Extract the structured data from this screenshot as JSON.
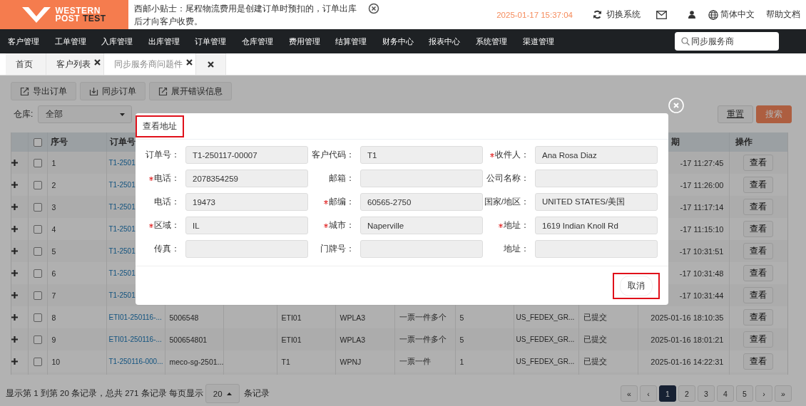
{
  "header": {
    "logo": {
      "line_1": "WESTERN",
      "line_2_a": "POST",
      "line_2_b": "TEST"
    },
    "notice": "西邮小贴士：尾程物流费用是创建订单时预扣的，订单出库后才向客户收费。",
    "datetime": "2025-01-17 15:37:04",
    "switch_system": "切换系统",
    "language": "简体中文",
    "help": "帮助文档"
  },
  "nav": {
    "items": [
      "客户管理",
      "工单管理",
      "入库管理",
      "出库管理",
      "订单管理",
      "仓库管理",
      "费用管理",
      "结算管理",
      "财务中心",
      "报表中心",
      "系统管理",
      "渠道管理"
    ],
    "search": {
      "value": "同步服务商"
    }
  },
  "tabs": [
    {
      "label": "首页",
      "closable": false,
      "selected": false
    },
    {
      "label": "客户列表",
      "closable": true,
      "selected": false
    },
    {
      "label": "同步服务商问题件",
      "closable": true,
      "selected": true
    },
    {
      "closable": true,
      "selected": false
    }
  ],
  "toolbar": [
    {
      "label": "导出订单",
      "kind": "export"
    },
    {
      "label": "同步订单",
      "kind": "download"
    },
    {
      "label": "展开错误信息",
      "kind": "export"
    }
  ],
  "filters": {
    "warehouse": {
      "label": "仓库:",
      "value": "全部"
    },
    "buttons": [
      {
        "label": "重置",
        "kind": "default"
      },
      {
        "label": "搜索",
        "kind": "primary"
      }
    ]
  },
  "table": {
    "all_checked": false,
    "headers": {
      "no": "序号",
      "order_no": "订单号",
      "date": "期",
      "action": "操作"
    },
    "rows": [
      {
        "checked": false,
        "no": "1",
        "order_no": "T1-2501",
        "date": "-17 11:27:45",
        "action": "查看"
      },
      {
        "checked": false,
        "no": "2",
        "order_no": "T1-2501",
        "date": "-17 11:26:00",
        "action": "查看"
      },
      {
        "checked": false,
        "no": "3",
        "order_no": "T1-2501",
        "date": "-17 11:17:14",
        "action": "查看"
      },
      {
        "checked": false,
        "no": "4",
        "order_no": "T1-2501",
        "date": "-17 11:15:10",
        "action": "查看"
      },
      {
        "checked": false,
        "no": "5",
        "order_no": "T1-2501",
        "date": "-17 10:31:51",
        "action": "查看"
      },
      {
        "checked": false,
        "no": "6",
        "order_no": "T1-2501",
        "date": "-17 10:31:48",
        "action": "查看"
      },
      {
        "checked": false,
        "no": "7",
        "order_no": "T1-2501",
        "date": "-17 10:31:44",
        "action": "查看"
      },
      {
        "checked": false,
        "no": "8",
        "order_no": "ETI01-250116-...",
        "column_3": "5006548",
        "column_5": "ETI01",
        "column_6": "WPLA3",
        "column_7": "一票一件多个",
        "column_8": "5",
        "column_9": "US_FEDEX_GR...",
        "column_10": "已提交",
        "date": "2025-01-16 18:10:35",
        "action": "查看"
      },
      {
        "checked": false,
        "no": "9",
        "order_no": "ETI01-250116-...",
        "column_3": "500654801",
        "column_5": "ETI01",
        "column_6": "WPLA3",
        "column_7": "一票一件多个",
        "column_8": "5",
        "column_9": "US_FEDEX_GR...",
        "column_10": "已提交",
        "date": "2025-01-16 18:01:21",
        "action": "查看"
      },
      {
        "checked": false,
        "no": "10",
        "order_no": "T1-250116-000...",
        "column_3": "meco-sg-2501...",
        "column_5": "T1",
        "column_6": "WPNJ",
        "column_7": "一票一件",
        "column_8": "1",
        "column_9": "US_FEDEX_GR...",
        "column_10": "已提交",
        "date": "2025-01-16 14:22:31",
        "action": "查看"
      }
    ]
  },
  "footer": {
    "summary": "显示第 1 到第 20 条记录，总共 271 条记录 每页显示",
    "page_size": "20",
    "suffix": "条记录",
    "pages": [
      {
        "label": "«",
        "selected": false
      },
      {
        "label": "‹",
        "selected": false
      },
      {
        "label": "1",
        "selected": true
      },
      {
        "label": "2",
        "selected": false
      },
      {
        "label": "3",
        "selected": false
      },
      {
        "label": "4",
        "selected": false
      },
      {
        "label": "5",
        "selected": false
      },
      {
        "label": "›",
        "selected": false
      },
      {
        "label": "»",
        "selected": false
      }
    ]
  },
  "modal": {
    "title": "查看地址",
    "title_highlighted": true,
    "fields": [
      {
        "label": "订单号：",
        "value": "T1-250117-00007",
        "required": false
      },
      {
        "label": "客户代码：",
        "value": "T1",
        "required": false
      },
      {
        "label": "收件人：",
        "value": "Ana Rosa Diaz",
        "required": true
      },
      {
        "label": "电话：",
        "value": "2078354259",
        "required": true
      },
      {
        "label": "邮箱：",
        "required": false
      },
      {
        "label": "公司名称：",
        "required": false
      },
      {
        "label": "电话：",
        "value": "19473",
        "required": false
      },
      {
        "label": "邮编：",
        "value": "60565-2750",
        "required": true
      },
      {
        "label": "国家/地区：",
        "value": "UNITED STATES/美国",
        "required": false
      },
      {
        "label": "区域：",
        "value": "IL",
        "required": true
      },
      {
        "label": "城市：",
        "value": "Naperville",
        "required": true
      },
      {
        "label": "地址：",
        "value": "1619 Indian Knoll Rd",
        "required": true
      },
      {
        "label": "传真：",
        "required": false
      },
      {
        "label": "门牌号：",
        "required": false
      },
      {
        "label": "地址：",
        "required": false
      }
    ],
    "buttons": [
      {
        "label": "取消",
        "highlighted": true
      }
    ]
  }
}
